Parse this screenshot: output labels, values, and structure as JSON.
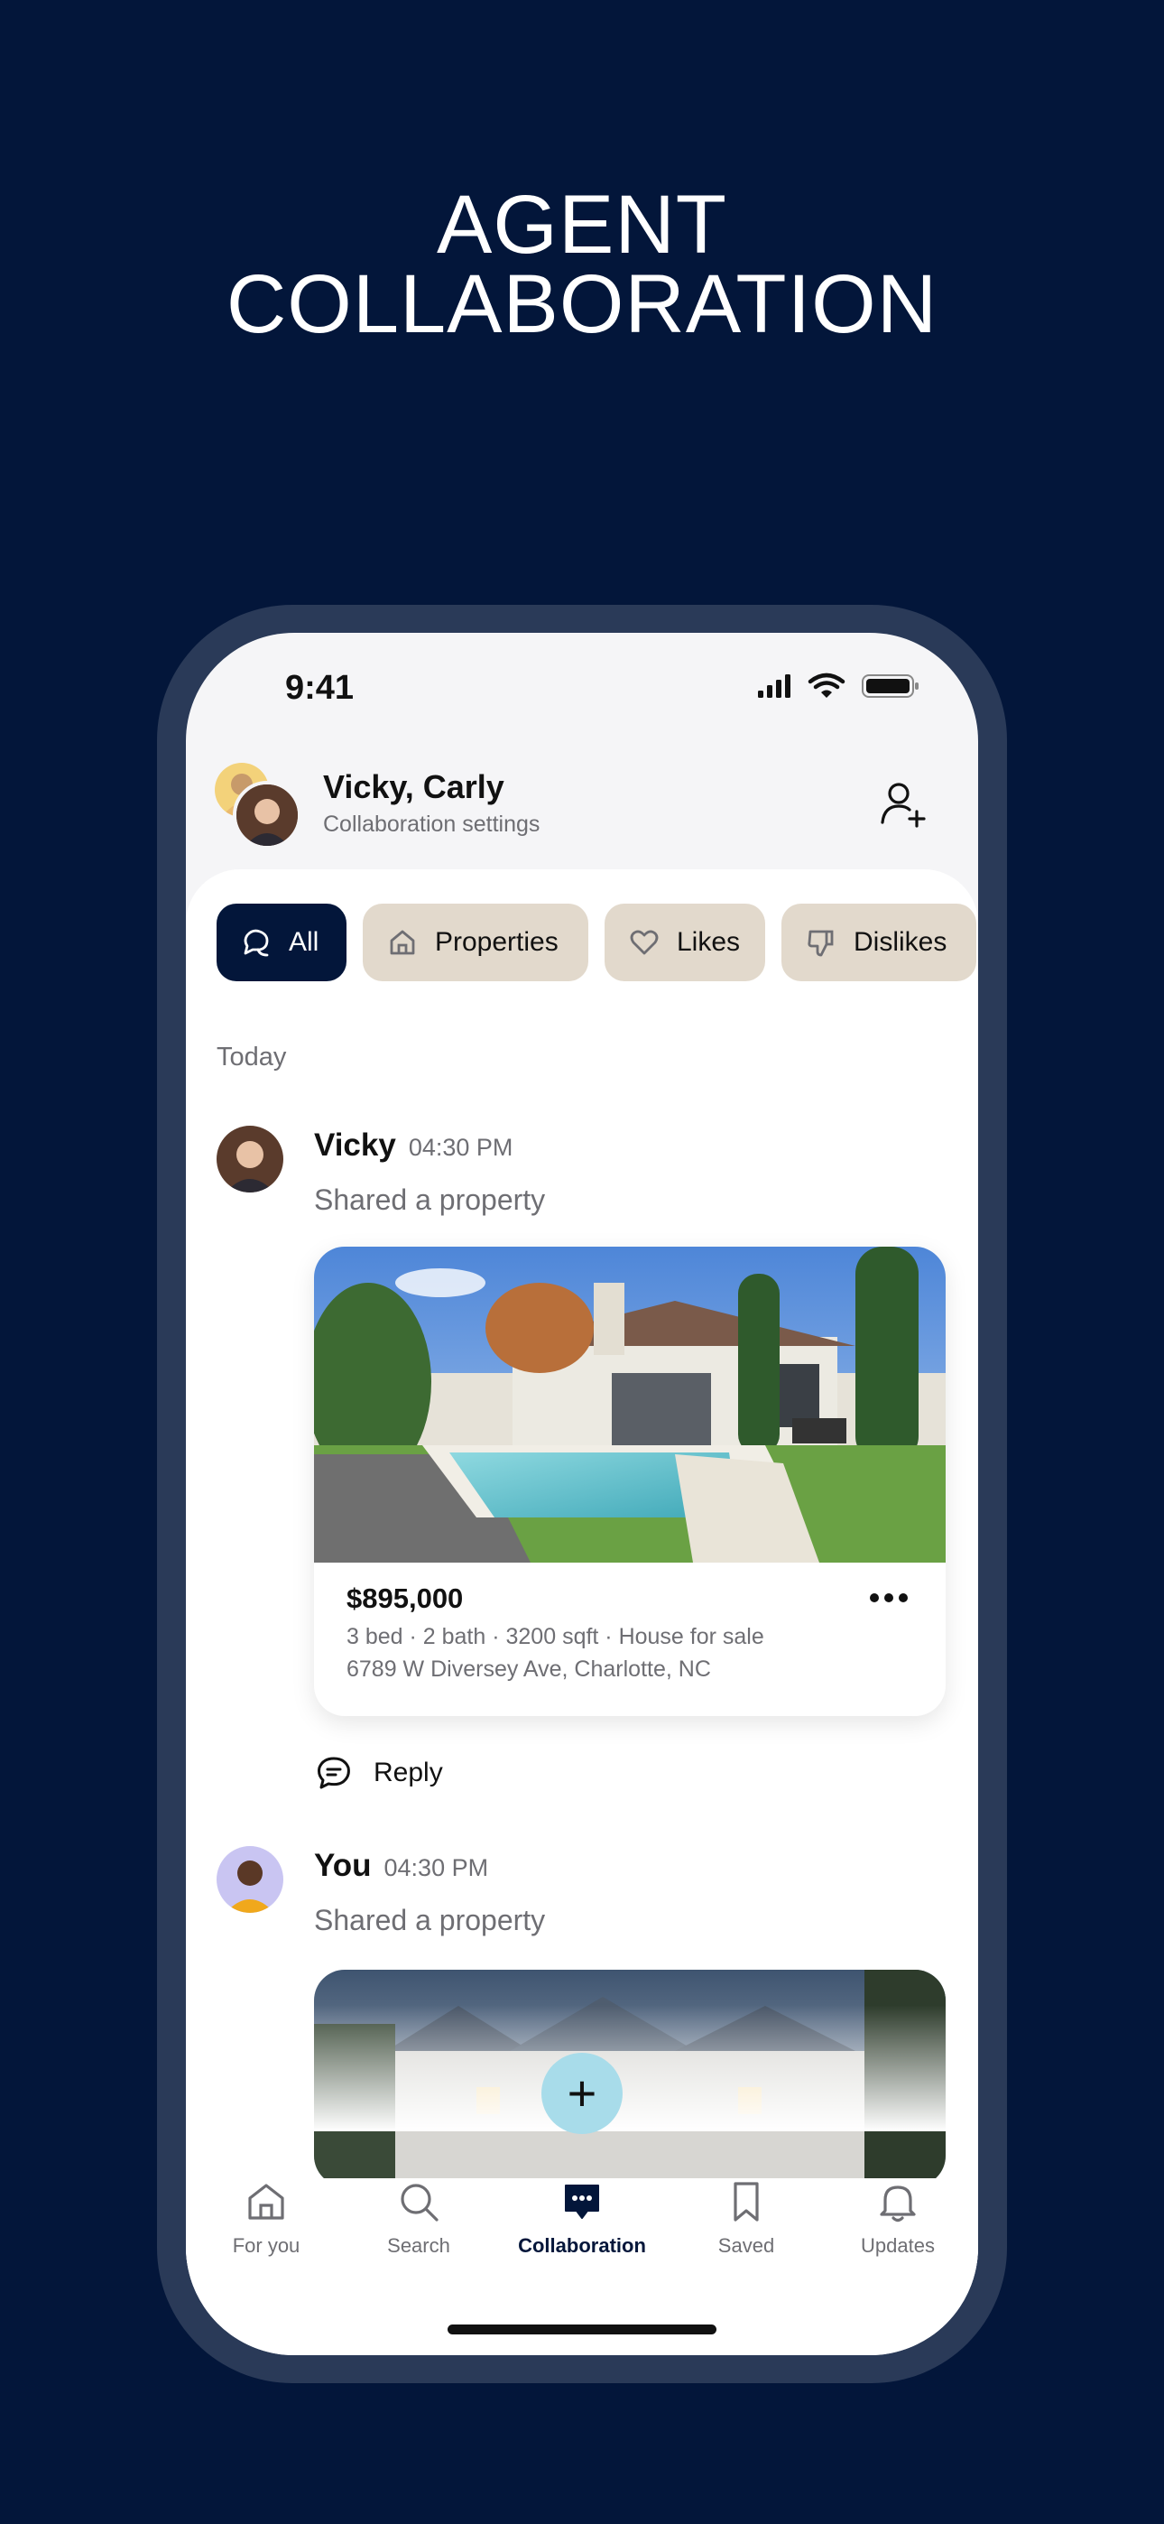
{
  "headline": {
    "line1": "AGENT",
    "line2": "COLLABORATION"
  },
  "status_bar": {
    "time": "9:41"
  },
  "header": {
    "title": "Vicky, Carly",
    "subtitle": "Collaboration settings",
    "add_user_icon": "add-person-icon"
  },
  "filters": [
    {
      "label": "All",
      "icon": "chat-bubbles-icon",
      "active": true
    },
    {
      "label": "Properties",
      "icon": "house-icon",
      "active": false
    },
    {
      "label": "Likes",
      "icon": "heart-icon",
      "active": false
    },
    {
      "label": "Dislikes",
      "icon": "thumbs-down-icon",
      "active": false
    }
  ],
  "feed": {
    "day_label": "Today",
    "messages": [
      {
        "author": "Vicky",
        "time": "04:30 PM",
        "text": "Shared a property",
        "property": {
          "price": "$895,000",
          "details": "3 bed · 2 bath · 3200 sqft · House for sale",
          "address": "6789 W Diversey Ave, Charlotte, NC"
        },
        "reply_label": "Reply"
      },
      {
        "author": "You",
        "time": "04:30 PM",
        "text": "Shared a property"
      }
    ]
  },
  "fab": {
    "label": "+"
  },
  "tabbar": {
    "tabs": [
      {
        "label": "For you",
        "icon": "home-icon",
        "active": false
      },
      {
        "label": "Search",
        "icon": "search-icon",
        "active": false
      },
      {
        "label": "Collaboration",
        "icon": "chat-icon",
        "active": true
      },
      {
        "label": "Saved",
        "icon": "bookmark-icon",
        "active": false
      },
      {
        "label": "Updates",
        "icon": "bell-icon",
        "active": false
      }
    ]
  },
  "colors": {
    "background": "#03163a",
    "accent": "#03163a",
    "chip": "#e2d9cc",
    "fab": "#a8dcea"
  }
}
